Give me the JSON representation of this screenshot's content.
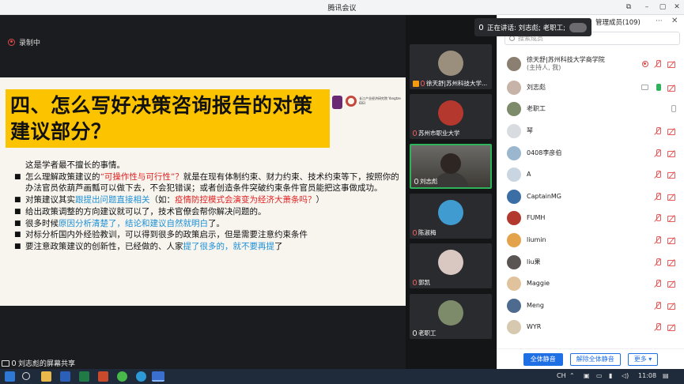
{
  "window": {
    "title": "腾讯会议"
  },
  "recording": {
    "label": "录制中"
  },
  "slide": {
    "title": "四、怎么写好决策咨询报告的对策建议部分？",
    "logo_text": "长江产业经济研究院 Yangtze IDEI",
    "intro": "这是学者最不擅长的事情。",
    "bullets": [
      {
        "parts": [
          {
            "t": "怎么理解政策建议的"
          },
          {
            "t": "“可操作性与可行性”？",
            "c": "red"
          },
          {
            "t": "就是在现有体制约束、财力约束、技术约束等下，按照你的办法官员依葫芦画瓢可以做下去，不会犯错误；或者创造条件突破约束条件官员能把这事做成功。"
          }
        ]
      },
      {
        "parts": [
          {
            "t": "对策建议其实"
          },
          {
            "t": "跟提出问题直接相关",
            "c": "blue"
          },
          {
            "t": "（如："
          },
          {
            "t": "疫情防控模式会演变为经济大萧条吗？",
            "c": "red"
          },
          {
            "t": "）"
          }
        ]
      },
      {
        "parts": [
          {
            "t": "给出政策调整的方向建议就可以了，技术官僚会帮你解决问题的。"
          }
        ]
      },
      {
        "parts": [
          {
            "t": "很多时候"
          },
          {
            "t": "原因分析清楚了，结论和建议自然就明白",
            "c": "blue"
          },
          {
            "t": "了。"
          }
        ]
      },
      {
        "parts": [
          {
            "t": "对标分析国内外经验教训，可以得到很多的政策启示，但是需要注意约束条件"
          }
        ]
      },
      {
        "parts": [
          {
            "t": "要注意政策建议的创新性，已经做的、人家"
          },
          {
            "t": "提了很多的，就不要再提",
            "c": "blue"
          },
          {
            "t": "了"
          }
        ]
      }
    ]
  },
  "screen_share": {
    "label": "刘志彪的屏幕共享"
  },
  "video_tiles": [
    {
      "name": "徐天舒|苏州科技大学...",
      "host": true,
      "muted": true,
      "avatar_color": "#9a8f7c"
    },
    {
      "name": "苏州市职业大学",
      "host": false,
      "muted": true,
      "avatar_color": "#b5382e"
    },
    {
      "name": "刘志彪",
      "host": false,
      "muted": false,
      "camera": true
    },
    {
      "name": "陈淑梅",
      "host": false,
      "muted": true,
      "avatar_color": "#3f9bd0"
    },
    {
      "name": "郭凯",
      "host": false,
      "muted": true,
      "avatar_color": "#d9c8c2"
    },
    {
      "name": "老职工",
      "host": false,
      "muted": false,
      "avatar_color": "#7d8b6a"
    }
  ],
  "speaking_banner": {
    "label": "正在讲话: 刘志彪; 老职工;"
  },
  "panel": {
    "title": "管理成员(109)",
    "search_placeholder": "搜索成员",
    "members": [
      {
        "name": "徐天舒|苏州科技大学商学院",
        "sub": "(主持人, 我)",
        "avatar_color": "#8a7f70",
        "icons": [
          "rec",
          "mute",
          "camoff"
        ]
      },
      {
        "name": "刘志彪",
        "sub": "",
        "avatar_color": "#c7b3a8",
        "icons": [
          "screen",
          "micon",
          "camoff"
        ]
      },
      {
        "name": "老职工",
        "sub": "",
        "avatar_color": "#7d8b6a",
        "icons": [
          "micgrey"
        ]
      },
      {
        "name": "琴",
        "sub": "",
        "avatar_color": "#d8dbe0",
        "icons": [
          "mute",
          "camoff"
        ]
      },
      {
        "name": "0408李彦伯",
        "sub": "",
        "avatar_color": "#9bb7cf",
        "icons": [
          "mute",
          "camoff"
        ]
      },
      {
        "name": "A",
        "sub": "",
        "avatar_color": "#c9d6e2",
        "icons": [
          "mute",
          "camoff"
        ]
      },
      {
        "name": "CaptainMG",
        "sub": "",
        "avatar_color": "#3a6ea5",
        "icons": [
          "mute",
          "camoff"
        ]
      },
      {
        "name": "FUMH",
        "sub": "",
        "avatar_color": "#b3392f",
        "icons": [
          "mute",
          "camoff"
        ]
      },
      {
        "name": "liumin",
        "sub": "",
        "avatar_color": "#e3a34b",
        "icons": [
          "mute",
          "camoff"
        ]
      },
      {
        "name": "liu果",
        "sub": "",
        "avatar_color": "#5a5552",
        "icons": [
          "mute",
          "camoff"
        ]
      },
      {
        "name": "Maggie",
        "sub": "",
        "avatar_color": "#e0c29c",
        "icons": [
          "mute",
          "camoff"
        ]
      },
      {
        "name": "Meng",
        "sub": "",
        "avatar_color": "#4d6b8f",
        "icons": [
          "mute",
          "camoff"
        ]
      },
      {
        "name": "WYR",
        "sub": "",
        "avatar_color": "#d6c9b0",
        "icons": [
          "mute",
          "camoff"
        ]
      }
    ],
    "mute_all_label": "全体静音",
    "unmute_all_label": "解除全体静音",
    "more_label": "更多 ▾"
  },
  "taskbar": {
    "ime": "CH",
    "clock": "11:08"
  },
  "colors": {
    "accent": "#1f6fe5",
    "title_bar": "#fcc400",
    "red_text": "#e02020",
    "blue_text": "#1c8fd6"
  }
}
